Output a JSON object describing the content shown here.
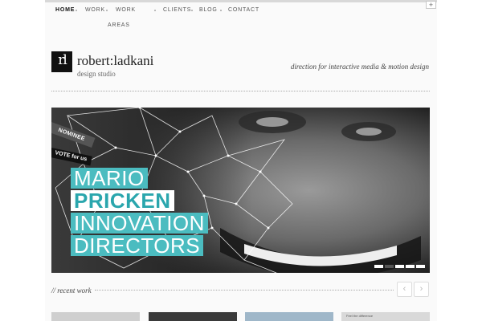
{
  "nav": {
    "items": [
      {
        "label": "HOME",
        "active": true
      },
      {
        "label": "WORK",
        "active": false
      },
      {
        "label": "WORK",
        "active": false
      },
      {
        "label": "AREAS",
        "active": false
      },
      {
        "label": "CLIENTS",
        "active": false
      },
      {
        "label": "BLOG",
        "active": false
      },
      {
        "label": "CONTACT",
        "active": false
      }
    ],
    "expand_symbol": "+"
  },
  "logo": {
    "mark": "rl",
    "name": "robert:ladkani",
    "sub": "design studio"
  },
  "tagline": "direction for interactive media & motion design",
  "hero": {
    "badge_nominee": "NOMINEE",
    "badge_vote": "VOTE for us",
    "lines": [
      "MARIO",
      "PRICKEN",
      "INNOVATION",
      "DIRECTORS"
    ],
    "slide_count": 5,
    "active_slide": 2
  },
  "recent_work": {
    "label": "// recent work",
    "prev_symbol": "‹",
    "next_symbol": "›",
    "thumbs": [
      {
        "caption": ""
      },
      {
        "caption": ""
      },
      {
        "caption": ""
      },
      {
        "caption": "Feel the difference"
      }
    ]
  },
  "colors": {
    "accent": "#4bbcc0",
    "accent_text": "#2aa6ad"
  }
}
